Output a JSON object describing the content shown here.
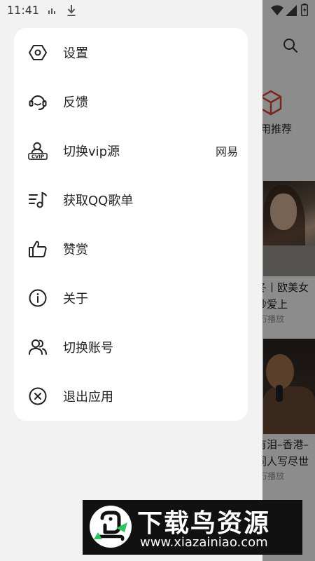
{
  "status_bar": {
    "time": "11:41",
    "icons": [
      "sim-icon",
      "download-icon",
      "wifi-icon",
      "signal-icon",
      "battery-icon"
    ]
  },
  "background": {
    "search_icon": "search-icon",
    "recommend_label": "用推荐",
    "playlists": [
      {
        "title_line1": "冬丨欧美女",
        "title_line2": "妙爱上",
        "plays": "万播放"
      },
      {
        "title_line1": "有泪–香港–",
        "title_line2": "同人写尽世",
        "plays": "万播放"
      }
    ]
  },
  "menu": {
    "items": [
      {
        "icon": "settings-icon",
        "label": "设置"
      },
      {
        "icon": "feedback-icon",
        "label": "反馈"
      },
      {
        "icon": "vip-icon",
        "label": "切换vip源",
        "value": "网易"
      },
      {
        "icon": "playlist-icon",
        "label": "获取QQ歌单"
      },
      {
        "icon": "thumbs-up-icon",
        "label": "赞赏"
      },
      {
        "icon": "info-icon",
        "label": "关于"
      },
      {
        "icon": "users-icon",
        "label": "切换账号"
      },
      {
        "icon": "close-circle-icon",
        "label": "退出应用"
      }
    ]
  },
  "watermark": {
    "title": "下载鸟资源",
    "url": "www.xiazainiao.com"
  },
  "colors": {
    "accent_red": "#d9453b",
    "watermark_green": "#2ec45f",
    "drawer_bg": "#f2f2f2",
    "card_bg": "#ffffff"
  }
}
